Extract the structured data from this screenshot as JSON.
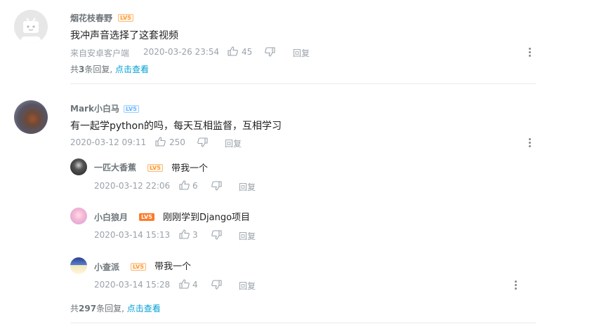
{
  "comments": [
    {
      "username": "烟花枝春野",
      "level": "LV5",
      "text": "我冲声音选择了这套视频",
      "source": "来自安卓客户端",
      "time": "2020-03-26 23:54",
      "likes": "45",
      "reply_label": "回复",
      "summary": {
        "prefix": "共",
        "count": "3",
        "suffix": "条回复,",
        "link": "点击查看"
      }
    },
    {
      "username": "Mark小白马",
      "level": "LV5",
      "text": "有一起学python的吗，每天互相监督，互相学习",
      "time": "2020-03-12 09:11",
      "likes": "250",
      "reply_label": "回复",
      "replies": [
        {
          "username": "一匹大香蕉",
          "level": "LV5",
          "text": "带我一个",
          "time": "2020-03-12 22:06",
          "likes": "6",
          "reply_label": "回复"
        },
        {
          "username": "小白狼月",
          "level": "LV5",
          "text": "刚刚学到Django项目",
          "time": "2020-03-14 15:13",
          "likes": "3",
          "reply_label": "回复"
        },
        {
          "username": "小查派",
          "level": "LV5",
          "text": "带我一个",
          "time": "2020-03-14 15:28",
          "likes": "4",
          "reply_label": "回复"
        }
      ],
      "summary": {
        "prefix": "共",
        "count": "297",
        "suffix": "条回复,",
        "link": "点击查看"
      }
    }
  ],
  "icons": {
    "like": "thumbs-up-icon",
    "dislike": "thumbs-down-icon",
    "more": "more-vertical-icon"
  },
  "colors": {
    "link": "#00a1d6",
    "meta": "#99a2aa",
    "level_orange": "#ff9b32",
    "level_blue": "#6ab7ff"
  }
}
